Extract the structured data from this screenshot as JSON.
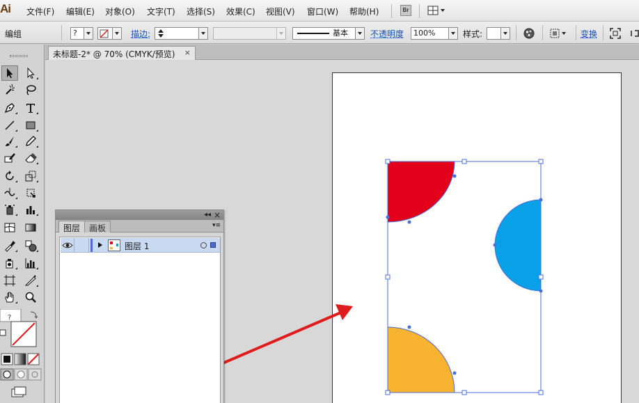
{
  "app": {
    "logo": "Ai"
  },
  "menu": [
    {
      "label": "文件(F)"
    },
    {
      "label": "编辑(E)"
    },
    {
      "label": "对象(O)"
    },
    {
      "label": "文字(T)"
    },
    {
      "label": "选择(S)"
    },
    {
      "label": "效果(C)"
    },
    {
      "label": "视图(V)"
    },
    {
      "label": "窗口(W)"
    },
    {
      "label": "帮助(H)"
    }
  ],
  "menubar_extra": {
    "bridge_label": "Br"
  },
  "control": {
    "selection_label": "编组",
    "stroke_label": "描边:",
    "stroke_profile": "基本",
    "opacity_label": "不透明度",
    "opacity_value": "100%",
    "style_label": "样式:",
    "transform_label": "变换",
    "help_glyph": "?"
  },
  "document": {
    "tab_title": "未标题-2* @ 70% (CMYK/预览)",
    "close_glyph": "×"
  },
  "layers_panel": {
    "collapse_glyph": "◂◂",
    "close_glyph": "×",
    "tabs": [
      {
        "label": "图层"
      },
      {
        "label": "画板"
      }
    ],
    "menu_glyph": "▾≡",
    "layers": [
      {
        "name": "图层 1"
      }
    ]
  },
  "colors": {
    "red_shape": "#e3001b",
    "blue_shape": "#08a0e6",
    "orange_shape": "#f8b330",
    "selection": "#4a6ed8",
    "arrow": "#e01b1b"
  },
  "icons": [
    "selection-tool-icon",
    "direct-selection-tool-icon",
    "magic-wand-icon",
    "lasso-icon",
    "pen-tool-icon",
    "type-tool-icon",
    "line-tool-icon",
    "rectangle-tool-icon",
    "paintbrush-icon",
    "pencil-icon",
    "blob-brush-icon",
    "eraser-icon",
    "rotate-icon",
    "scale-icon",
    "warp-icon",
    "free-transform-icon",
    "symbol-sprayer-icon",
    "column-graph-icon",
    "mesh-icon",
    "gradient-icon",
    "eyedropper-icon",
    "blend-icon",
    "slice-icon",
    "hand-icon",
    "zoom-icon",
    "artboard-icon"
  ]
}
